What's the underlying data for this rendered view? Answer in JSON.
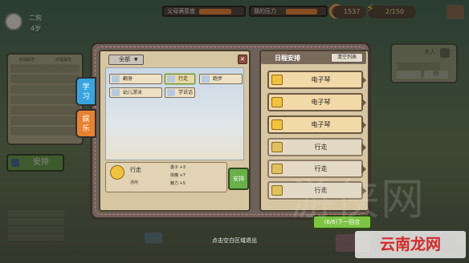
{
  "hud": {
    "name": "二狗",
    "age": "4岁",
    "parent_satisfaction_label": "父母满意度",
    "parent_satisfaction_value": 0.72,
    "stress_label": "我的压力",
    "stress_value": 0.78,
    "money": "1537",
    "energy": "2/150"
  },
  "stat_panel": {
    "headers": [
      "当前属性",
      "天赋属性"
    ]
  },
  "side": {
    "arrange_label": "安排"
  },
  "right_panel": {
    "name_label": "夫人",
    "button_label": "回"
  },
  "tabs": [
    {
      "label": "学习",
      "color": "#39a5e0"
    },
    {
      "label": "娱乐",
      "color": "#e88233"
    }
  ],
  "activity_panel": {
    "filter_label": "全部",
    "close_label": "×",
    "activities": [
      {
        "label": "翻身",
        "selected": false
      },
      {
        "label": "行走",
        "selected": true
      },
      {
        "label": "跑步",
        "selected": false
      },
      {
        "label": "幼儿游泳",
        "selected": false
      },
      {
        "label": "学说话",
        "selected": false
      }
    ]
  },
  "detail": {
    "title": "行走",
    "subtitle": "通用",
    "effects": [
      "勇子 +3",
      "体魄 +7",
      "魅力 +5"
    ],
    "arrange_label": "安排"
  },
  "schedule": {
    "title": "日程安排",
    "clear_label": "清空列表",
    "slots": [
      {
        "label": "电子琴",
        "active": true
      },
      {
        "label": "电子琴",
        "active": true
      },
      {
        "label": "电子琴",
        "active": true
      },
      {
        "label": "行走",
        "active": false
      },
      {
        "label": "行走",
        "active": false
      },
      {
        "label": "行走",
        "active": false
      }
    ]
  },
  "next_round_label": "(6/6)下一回合",
  "exit_hint": "点击空白区域退出",
  "bottom": {
    "right_label": "事"
  },
  "watermark": {
    "big_text": "游侠网",
    "badge_text": "云南龙网"
  }
}
